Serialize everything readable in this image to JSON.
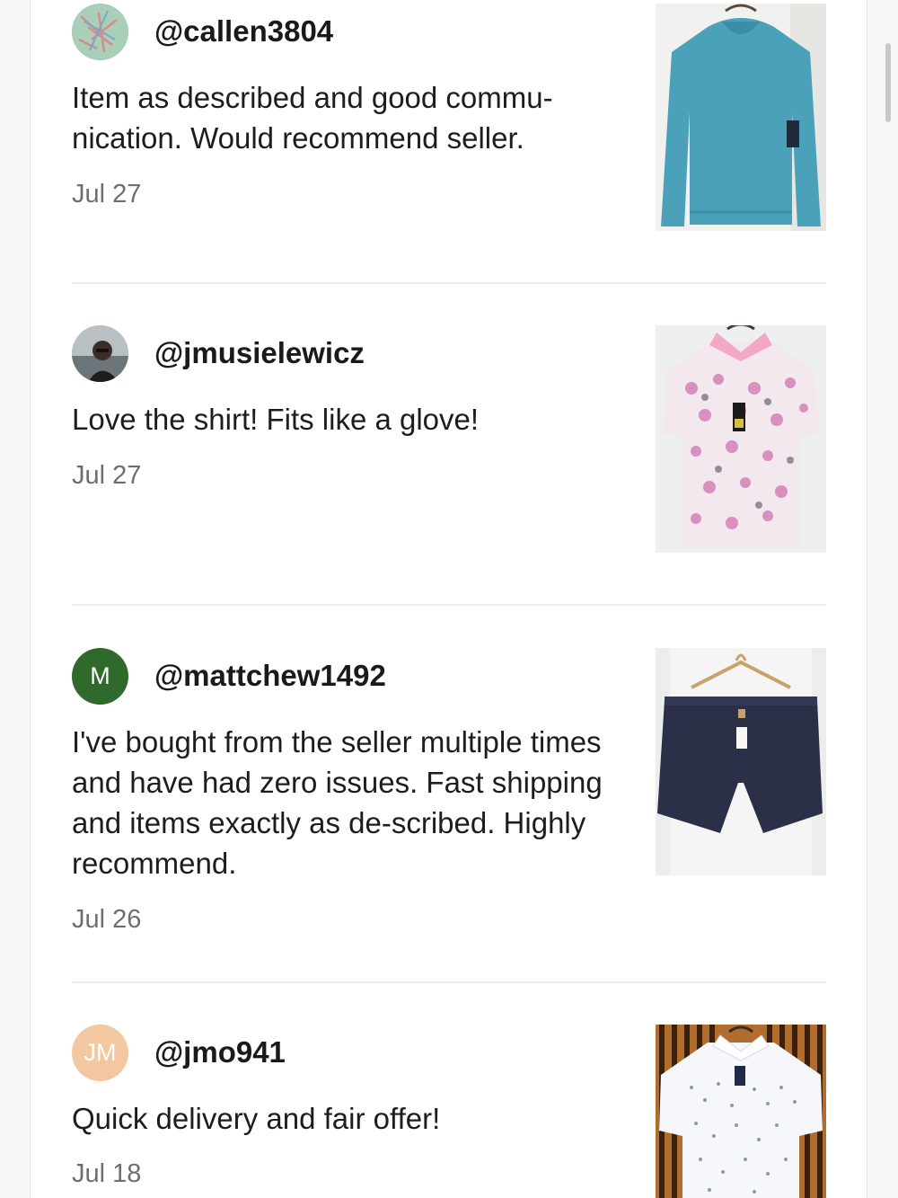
{
  "colors": {
    "avatar_mattchew_bg": "#2f6a2c",
    "avatar_jmo_bg": "#f3c79f",
    "avatar_jmo_text": "#ffffff",
    "date_text": "#6e6e6e",
    "divider": "#ececec"
  },
  "reviews": [
    {
      "username": "@callen3804",
      "comment": "Item as described and good commu-nication. Would recommend seller.",
      "date": "Jul 27",
      "avatar": "pattern-avatar",
      "item": "teal-hoodie-thumbnail"
    },
    {
      "username": "@jmusielewicz",
      "comment": "Love the shirt! Fits like a glove!",
      "date": "Jul 27",
      "avatar": "photo-avatar",
      "item": "floral-polo-thumbnail"
    },
    {
      "username": "@mattchew1492",
      "comment": "I've bought from the seller multiple times and have had zero issues. Fast shipping and items exactly as de-scribed. Highly recommend.",
      "date": "Jul 26",
      "avatar_initials": "M",
      "item": "navy-shorts-thumbnail"
    },
    {
      "username": "@jmo941",
      "comment": "Quick delivery and fair offer!",
      "date": "Jul 18",
      "avatar_initials": "JM",
      "item": "white-print-shirt-thumbnail"
    }
  ]
}
